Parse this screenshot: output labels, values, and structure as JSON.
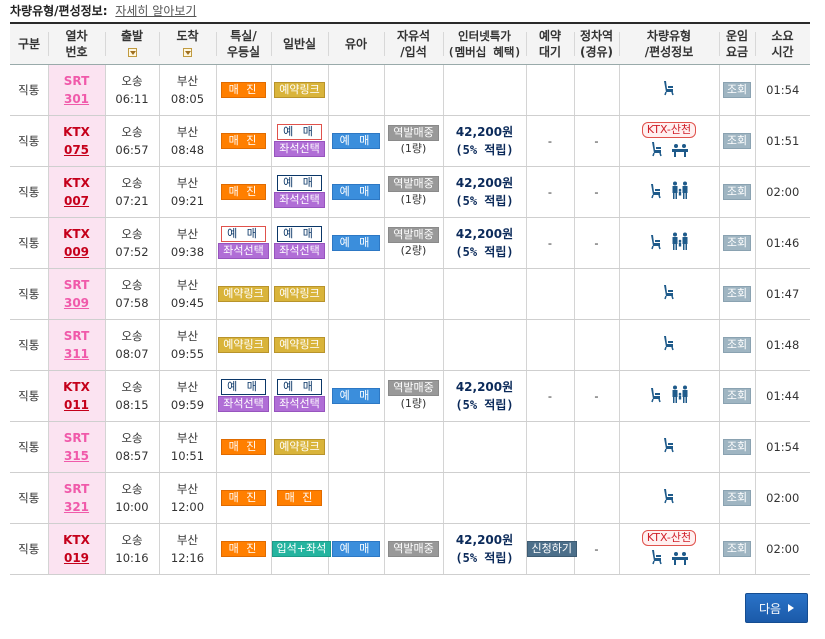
{
  "info": {
    "label": "차량유형/편성정보:",
    "link": "자세히 알아보기"
  },
  "headers": {
    "type": "구분",
    "train": [
      "열차",
      "번호"
    ],
    "dep": "출발",
    "arr": "도착",
    "special": [
      "특실/",
      "우등실"
    ],
    "general": "일반실",
    "baby": "유아",
    "free": [
      "자유석",
      "/입석"
    ],
    "internet": [
      "인터넷특가",
      "(멤버십 혜택)"
    ],
    "reserve": [
      "예약",
      "대기"
    ],
    "stop": [
      "정차역",
      "(경유)"
    ],
    "vehicle": [
      "차량유형",
      "/편성정보"
    ],
    "fare": [
      "운임",
      "요금"
    ],
    "duration": [
      "소요",
      "시간"
    ]
  },
  "labels": {
    "sold": "매 진",
    "rsv": "예약링크",
    "buy": "예 매",
    "seat": "좌석선택",
    "baby": "예 매",
    "free": "역발매중",
    "price": "42,200원",
    "points": "(5% 적립)",
    "dash": "-",
    "ktx_tag": "KTX-산천",
    "fare": "조회",
    "next": "다음"
  },
  "rows": [
    {
      "kind": "직통",
      "brand": "SRT",
      "num": "301",
      "dep_st": "오송",
      "dep": "06:11",
      "arr_st": "부산",
      "arr": "08:05",
      "special": "sold",
      "general": "rsv",
      "baby": "",
      "free": "",
      "cars": "",
      "internet": false,
      "reserve": "",
      "stop": "",
      "vehicle": "srt",
      "duration": "01:54"
    },
    {
      "kind": "직통",
      "brand": "KTX",
      "num": "075",
      "dep_st": "오송",
      "dep": "06:57",
      "arr_st": "부산",
      "arr": "08:48",
      "special": "sold",
      "general": "buy-red+seat",
      "baby": "buy",
      "free": "free",
      "cars": "(1량)",
      "internet": true,
      "reserve": "-",
      "stop": "-",
      "vehicle": "sancheon",
      "duration": "01:51"
    },
    {
      "kind": "직통",
      "brand": "KTX",
      "num": "007",
      "dep_st": "오송",
      "dep": "07:21",
      "arr_st": "부산",
      "arr": "09:21",
      "special": "sold",
      "general": "buy+seat",
      "baby": "buy",
      "free": "free",
      "cars": "(1량)",
      "internet": true,
      "reserve": "-",
      "stop": "-",
      "vehicle": "ktx",
      "duration": "02:00"
    },
    {
      "kind": "직통",
      "brand": "KTX",
      "num": "009",
      "dep_st": "오송",
      "dep": "07:52",
      "arr_st": "부산",
      "arr": "09:38",
      "special": "buy-red+seat",
      "general": "buy+seat",
      "baby": "buy",
      "free": "free",
      "cars": "(2량)",
      "internet": true,
      "reserve": "-",
      "stop": "-",
      "vehicle": "ktx",
      "duration": "01:46"
    },
    {
      "kind": "직통",
      "brand": "SRT",
      "num": "309",
      "dep_st": "오송",
      "dep": "07:58",
      "arr_st": "부산",
      "arr": "09:45",
      "special": "rsv",
      "general": "rsv",
      "baby": "",
      "free": "",
      "cars": "",
      "internet": false,
      "reserve": "",
      "stop": "",
      "vehicle": "srt",
      "duration": "01:47"
    },
    {
      "kind": "직통",
      "brand": "SRT",
      "num": "311",
      "dep_st": "오송",
      "dep": "08:07",
      "arr_st": "부산",
      "arr": "09:55",
      "special": "rsv",
      "general": "rsv",
      "baby": "",
      "free": "",
      "cars": "",
      "internet": false,
      "reserve": "",
      "stop": "",
      "vehicle": "srt",
      "duration": "01:48"
    },
    {
      "kind": "직통",
      "brand": "KTX",
      "num": "011",
      "dep_st": "오송",
      "dep": "08:15",
      "arr_st": "부산",
      "arr": "09:59",
      "special": "buy+seat",
      "general": "buy+seat",
      "baby": "buy",
      "free": "free",
      "cars": "(1량)",
      "internet": true,
      "reserve": "-",
      "stop": "-",
      "vehicle": "ktx",
      "duration": "01:44"
    },
    {
      "kind": "직통",
      "brand": "SRT",
      "num": "315",
      "dep_st": "오송",
      "dep": "08:57",
      "arr_st": "부산",
      "arr": "10:51",
      "special": "sold",
      "general": "rsv",
      "baby": "",
      "free": "",
      "cars": "",
      "internet": false,
      "reserve": "",
      "stop": "",
      "vehicle": "srt",
      "duration": "01:54"
    },
    {
      "kind": "직통",
      "brand": "SRT",
      "num": "321",
      "dep_st": "오송",
      "dep": "10:00",
      "arr_st": "부산",
      "arr": "12:00",
      "special": "sold",
      "general": "sold",
      "baby": "",
      "free": "",
      "cars": "",
      "internet": false,
      "reserve": "",
      "stop": "",
      "vehicle": "srt",
      "duration": "02:00"
    },
    {
      "kind": "직통",
      "brand": "KTX",
      "num": "019",
      "dep_st": "오송",
      "dep": "10:16",
      "arr_st": "부산",
      "arr": "12:16",
      "special": "sold",
      "general": "combo",
      "combo_label": "입석+좌석",
      "baby": "buy",
      "free": "free",
      "cars": "",
      "internet": true,
      "reserve": "wait",
      "wait_label": "신청하기",
      "stop": "-",
      "vehicle": "sancheon",
      "duration": "02:00"
    }
  ]
}
